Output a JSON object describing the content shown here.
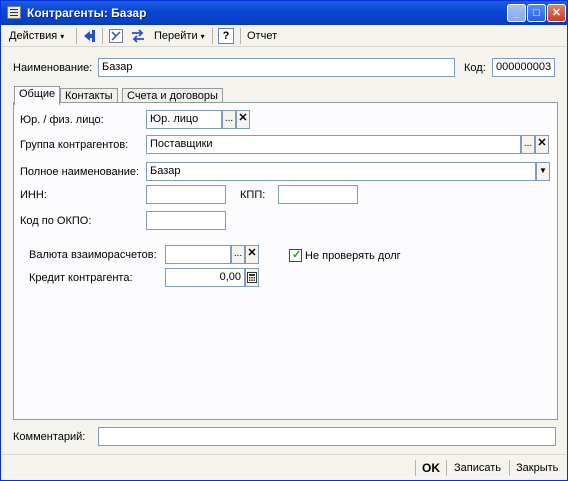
{
  "window": {
    "title": "Контрагенты: Базар"
  },
  "toolbar": {
    "actions_label": "Действия",
    "goto_label": "Перейти",
    "help_label": "?",
    "report_label": "Отчет"
  },
  "header": {
    "name_label": "Наименование:",
    "name_value": "Базар",
    "code_label": "Код:",
    "code_value": "000000003"
  },
  "tabs": [
    {
      "label": "Общие",
      "active": true
    },
    {
      "label": "Контакты",
      "active": false
    },
    {
      "label": "Счета и договоры",
      "active": false
    }
  ],
  "general": {
    "legal_label": "Юр. / физ. лицо:",
    "legal_value": "Юр. лицо",
    "group_label": "Группа контрагентов:",
    "group_value": "Поставщики",
    "fullname_label": "Полное наименование:",
    "fullname_value": "Базар",
    "inn_label": "ИНН:",
    "inn_value": "",
    "kpp_label": "КПП:",
    "kpp_value": "",
    "okpo_label": "Код по ОКПО:",
    "okpo_value": "",
    "currency_label": "Валюта взаиморасчетов:",
    "currency_value": "",
    "nocheck_label": "Не проверять долг",
    "nocheck_checked": true,
    "credit_label": "Кредит контрагента:",
    "credit_value": "0,00"
  },
  "comment": {
    "label": "Комментарий:",
    "value": ""
  },
  "buttons": {
    "ok": "OK",
    "save": "Записать",
    "close": "Закрыть"
  },
  "ellipsis": "...",
  "clear": "✕"
}
